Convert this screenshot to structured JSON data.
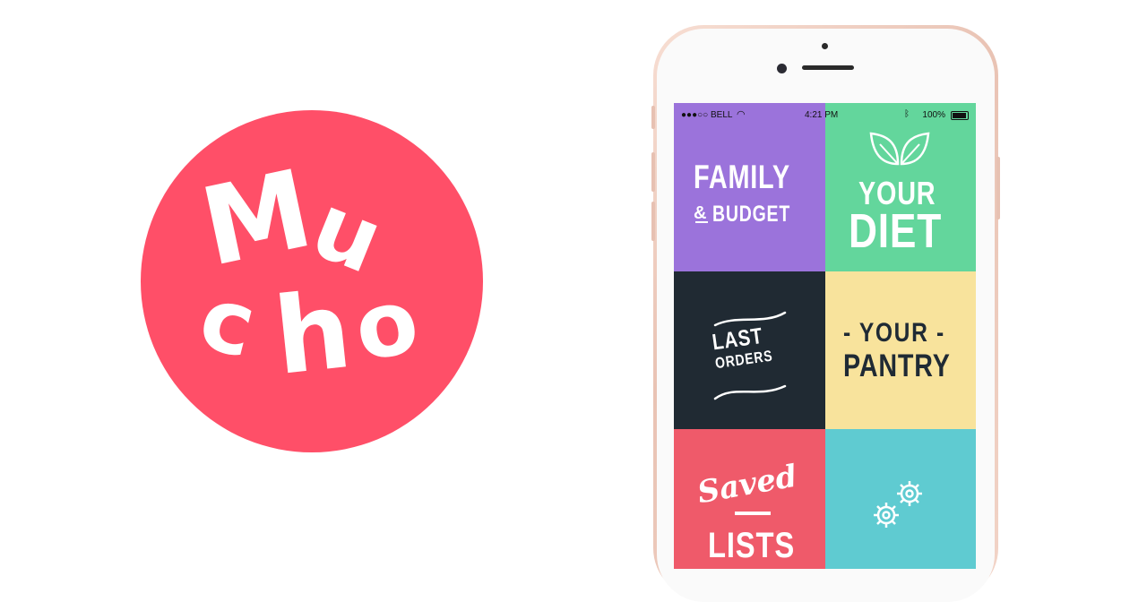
{
  "logo": {
    "letters": [
      "M",
      "u",
      "c",
      "h",
      "o"
    ],
    "color": "#ff4f68"
  },
  "status_bar": {
    "carrier": "●●●○○ BELL",
    "time": "4:21 PM",
    "battery": "100%",
    "icons": [
      "wifi-icon",
      "bluetooth-icon",
      "battery-icon"
    ]
  },
  "tiles": [
    {
      "line1": "FAMILY",
      "amp": "&",
      "line2": "BUDGET",
      "color": "#9b73db"
    },
    {
      "icon": "leaf-icon",
      "line1": "YOUR",
      "line2": "DIET",
      "color": "#63d69c"
    },
    {
      "line1": "LAST",
      "line2": "ORDERS",
      "color": "#202a33"
    },
    {
      "line1": "- YOUR -",
      "line2": "PANTRY",
      "color": "#f8e39c"
    },
    {
      "line1": "Saved",
      "line2": "LISTS",
      "color": "#ef5a6a"
    },
    {
      "icon": "gears-icon",
      "color": "#5fcbd1"
    }
  ]
}
